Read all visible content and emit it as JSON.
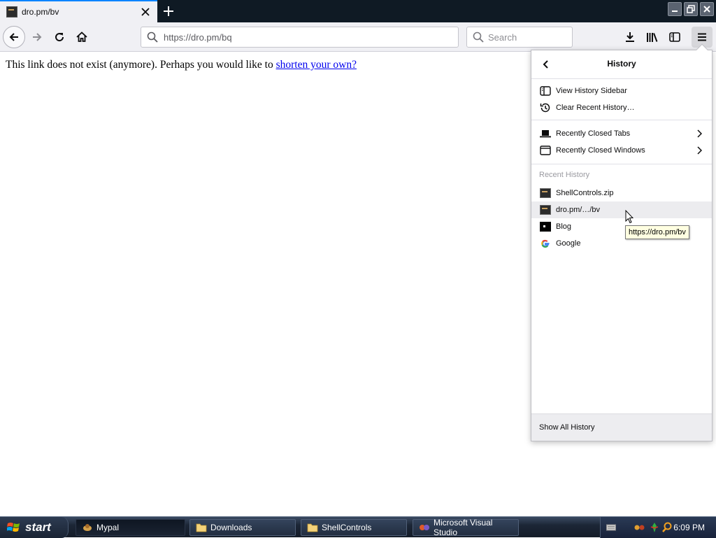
{
  "browser": {
    "tab": {
      "title": "dro.pm/bv"
    },
    "url": "https://dro.pm/bq",
    "search_placeholder": "Search"
  },
  "page": {
    "text": "This link does not exist (anymore). Perhaps you would like to",
    "link_text": "shorten your own?"
  },
  "history_panel": {
    "title": "History",
    "items": [
      {
        "label": "View History Sidebar",
        "icon": "sidebar-icon"
      },
      {
        "label": "Clear Recent History…",
        "icon": "history-clock-icon"
      },
      {
        "label": "Recently Closed Tabs",
        "icon": "closed-tab-icon"
      },
      {
        "label": "Recently Closed Windows",
        "icon": "window-icon"
      }
    ],
    "recent_label": "Recent History",
    "recent": [
      {
        "label": "ShellControls.zip",
        "icon": "favicon-dark"
      },
      {
        "label": "dro.pm/…/bv",
        "icon": "favicon-dark"
      },
      {
        "label": "Blog",
        "icon": "favicon-blog"
      },
      {
        "label": "Google",
        "icon": "google-icon"
      }
    ],
    "footer": "Show All History",
    "tooltip": "https://dro.pm/bv"
  },
  "taskbar": {
    "start": "start",
    "buttons": [
      {
        "label": "Mypal",
        "icon": "mypal-icon"
      },
      {
        "label": "Downloads",
        "icon": "folder-icon"
      },
      {
        "label": "ShellControls",
        "icon": "folder-icon"
      },
      {
        "label": "Microsoft Visual Studio",
        "icon": "visual-studio-icon"
      }
    ],
    "clock": "6:09 PM"
  },
  "colors": {
    "tab_strip": "#0f1a24",
    "toolbar": "#f0f0f4",
    "accent": "#0a84ff",
    "link": "#0000ee",
    "taskbar": "#1c2636"
  }
}
